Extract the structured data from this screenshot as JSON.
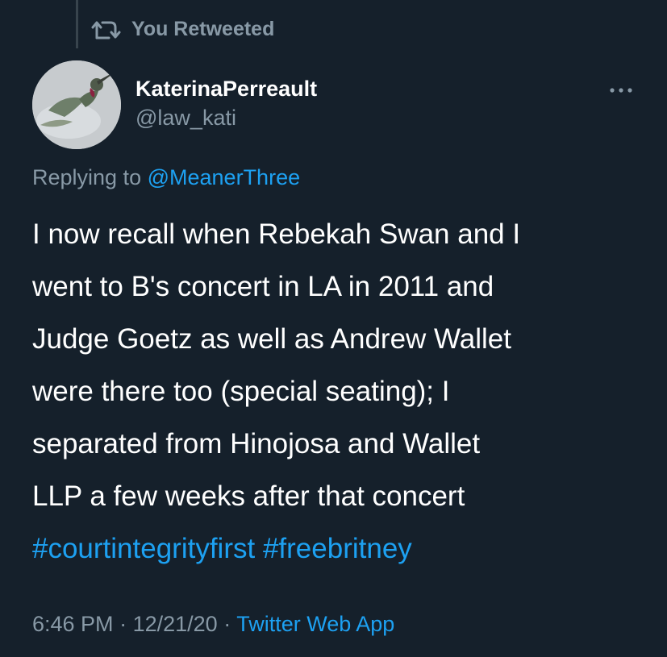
{
  "retweet": {
    "label": "You Retweeted",
    "icon": "retweet-icon"
  },
  "author": {
    "display_name": "KaterinaPerreault",
    "handle": "@law_kati",
    "avatar": "hummingbird-avatar"
  },
  "menu": {
    "icon": "more-options-icon"
  },
  "reply": {
    "prefix": "Replying to",
    "mention": "@MeanerThree"
  },
  "tweet": {
    "lines": [
      "I now recall when Rebekah Swan and I",
      "went to B's concert in LA in 2011 and",
      "Judge Goetz as well as Andrew Wallet",
      "were there too (special seating); I",
      "separated from Hinojosa and Wallet",
      "LLP a few weeks after that concert"
    ],
    "hashtags": [
      "#courtintegrityfirst",
      "#freebritney"
    ]
  },
  "meta": {
    "time": "6:46 PM",
    "separator": "·",
    "date": "12/21/20",
    "source": "Twitter Web App"
  },
  "colors": {
    "background": "#15202b",
    "text": "#ffffff",
    "secondary": "#8899a6",
    "accent": "#1da1f2",
    "divider": "#38444d"
  }
}
